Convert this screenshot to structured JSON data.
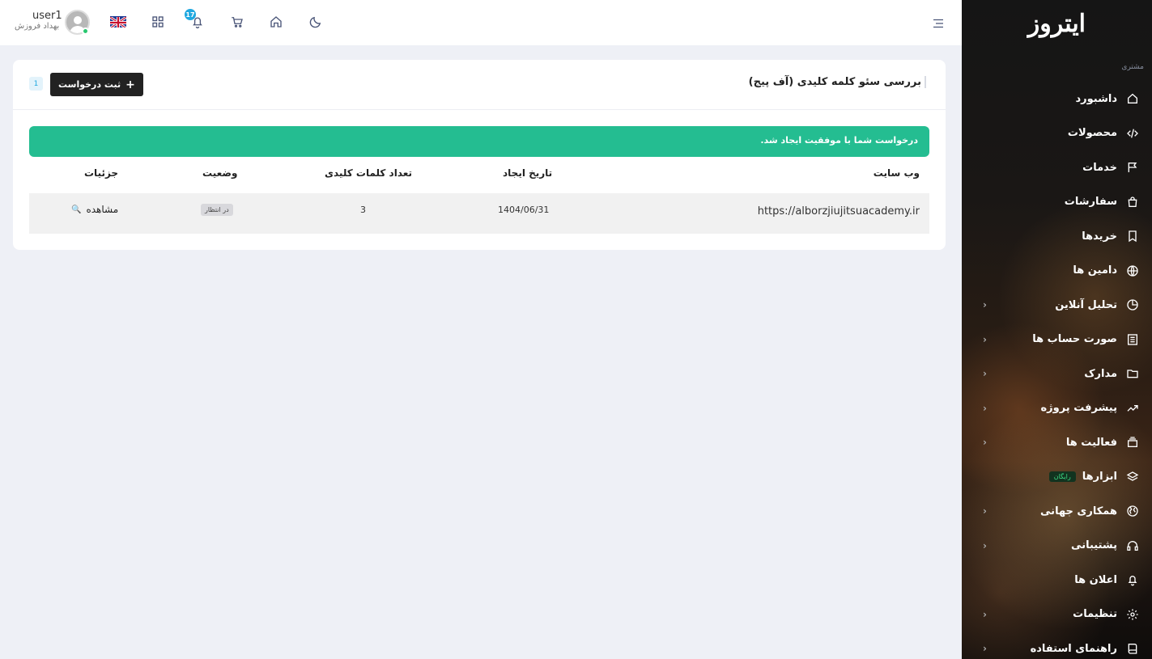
{
  "sidebar": {
    "logo": "ایتروز",
    "section_label": "مشتری",
    "items": [
      {
        "label": "داشبورد",
        "icon": "home-icon",
        "has_chevron": false
      },
      {
        "label": "محصولات",
        "icon": "code-icon",
        "has_chevron": false
      },
      {
        "label": "خدمات",
        "icon": "flag-icon",
        "has_chevron": false
      },
      {
        "label": "سفارشات",
        "icon": "bag-icon",
        "has_chevron": false
      },
      {
        "label": "خریدها",
        "icon": "bookmark-icon",
        "has_chevron": false
      },
      {
        "label": "دامین ها",
        "icon": "globe-icon",
        "has_chevron": false
      },
      {
        "label": "تحلیل آنلاین",
        "icon": "pie-icon",
        "has_chevron": true
      },
      {
        "label": "صورت حساب ها",
        "icon": "invoice-icon",
        "has_chevron": true
      },
      {
        "label": "مدارک",
        "icon": "folder-icon",
        "has_chevron": true
      },
      {
        "label": "پیشرفت پروژه",
        "icon": "trend-icon",
        "has_chevron": true
      },
      {
        "label": "فعالیت ها",
        "icon": "layers-icon",
        "has_chevron": true
      },
      {
        "label": "ابزارها",
        "icon": "stack-icon",
        "has_chevron": false,
        "badge": "رایگان"
      },
      {
        "label": "همکاری جهانی",
        "icon": "earth-icon",
        "has_chevron": true
      },
      {
        "label": "پشتیبانی",
        "icon": "headset-icon",
        "has_chevron": true
      },
      {
        "label": "اعلان ها",
        "icon": "bell-icon",
        "has_chevron": false
      },
      {
        "label": "تنظیمات",
        "icon": "gear-icon",
        "has_chevron": true
      },
      {
        "label": "راهنمای استفاده",
        "icon": "book-icon",
        "has_chevron": true
      }
    ]
  },
  "header": {
    "username": "user1",
    "user_role": "بهداد فروزش",
    "notification_count": "17",
    "flag": "uk-flag-icon"
  },
  "card": {
    "title": "بررسی سئو کلمه کلیدی (آف پیج)",
    "add_button": "ثبت درخواست",
    "count": "1",
    "alert": "درخواست شما با موفقیت ایجاد شد.",
    "columns": {
      "website": "وب سایت",
      "created": "تاریخ ایجاد",
      "keywords": "تعداد کلمات کلیدی",
      "status": "وضعیت",
      "details": "جزئیات"
    },
    "rows": [
      {
        "website": "https://alborzjiujitsuacademy.ir",
        "created": "1404/06/31",
        "keywords": "3",
        "status": "در انتظار",
        "details": "مشاهده"
      }
    ]
  },
  "colors": {
    "alert_bg": "#24bd91",
    "button_bg": "#222222",
    "notif_badge": "#1fa8e0",
    "online": "#28c76f"
  }
}
